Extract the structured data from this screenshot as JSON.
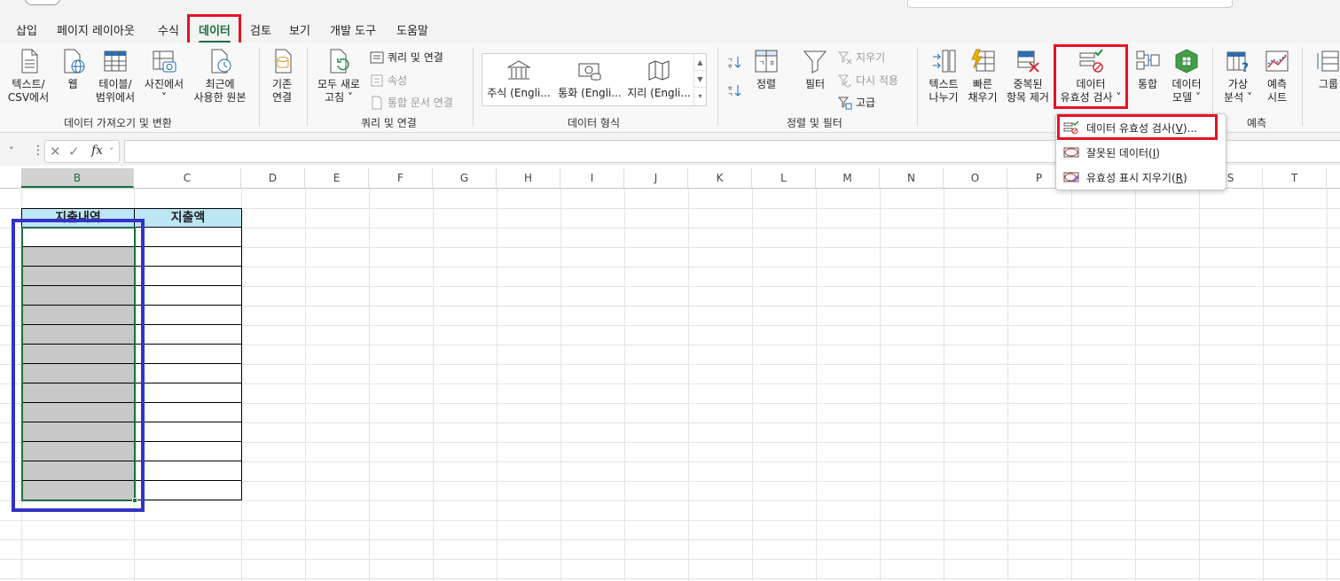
{
  "tabs": [
    {
      "label": "삽입"
    },
    {
      "label": "페이지 레이아웃"
    },
    {
      "label": "수식"
    },
    {
      "label": "데이터",
      "active": true
    },
    {
      "label": "검토"
    },
    {
      "label": "보기"
    },
    {
      "label": "개발 도구"
    },
    {
      "label": "도움말"
    }
  ],
  "ribbon": {
    "get_data": {
      "text_csv": "텍스트/\nCSV에서",
      "web": "웹",
      "table_range": "테이블/\n범위에서",
      "from_picture": "사진에서\n˅",
      "recent_sources": "최근에\n사용한 원본",
      "existing_connections": "기존\n연결",
      "group_label": "데이터 가져오기 및 변환"
    },
    "queries": {
      "refresh_all": "모두 새로\n고침 ˅",
      "queries_connections": "쿼리 및 연결",
      "properties": "속성",
      "edit_links": "통합 문서 연결",
      "group_label": "쿼리 및 연결"
    },
    "data_types": {
      "stocks": "주식 (Engli...",
      "currencies": "통화 (Engli...",
      "geography": "지리 (Engli...",
      "group_label": "데이터 형식"
    },
    "sort_filter": {
      "sort": "정렬",
      "filter": "필터",
      "clear": "지우기",
      "reapply": "다시 적용",
      "advanced": "고급",
      "group_label": "정렬 및 필터"
    },
    "data_tools": {
      "text_to_columns": "텍스트\n나누기",
      "flash_fill": "빠른\n채우기",
      "remove_duplicates": "중복된\n항목 제거",
      "data_validation": "데이터\n유효성 검사 ˅",
      "consolidate": "통합",
      "data_model": "데이터\n모델 ˅",
      "group_label": "데이"
    },
    "forecast": {
      "what_if": "가상\n분석 ˅",
      "forecast_sheet": "예측\n시트",
      "group_label": "예측"
    },
    "outline": {
      "group": "그룹"
    }
  },
  "formula_bar": {
    "fx": "fx",
    "value": ""
  },
  "columns": [
    "B",
    "C",
    "D",
    "E",
    "F",
    "G",
    "H",
    "I",
    "J",
    "K",
    "L",
    "M",
    "N",
    "O",
    "P",
    "Q",
    "R",
    "S",
    "T"
  ],
  "selected_column": "B",
  "table": {
    "headers": [
      "지출내역",
      "지출액"
    ],
    "row_count": 14
  },
  "dropdown": {
    "items": [
      {
        "label": "데이터 유효성 검사(",
        "key": "V",
        "suffix": ")...",
        "icon": "data-validation-icon"
      },
      {
        "label": "잘못된 데이터(",
        "key": "I",
        "suffix": ")",
        "icon": "circle-invalid-icon"
      },
      {
        "label": "유효성 표시 지우기(",
        "key": "R",
        "suffix": ")",
        "icon": "clear-circles-icon"
      }
    ]
  },
  "colors": {
    "accent_green": "#1e6e3f",
    "highlight_red": "#e81123",
    "highlight_blue": "#3232c8",
    "table_header_fill": "#bde6f5",
    "gray_fill": "#c8c8c8"
  }
}
